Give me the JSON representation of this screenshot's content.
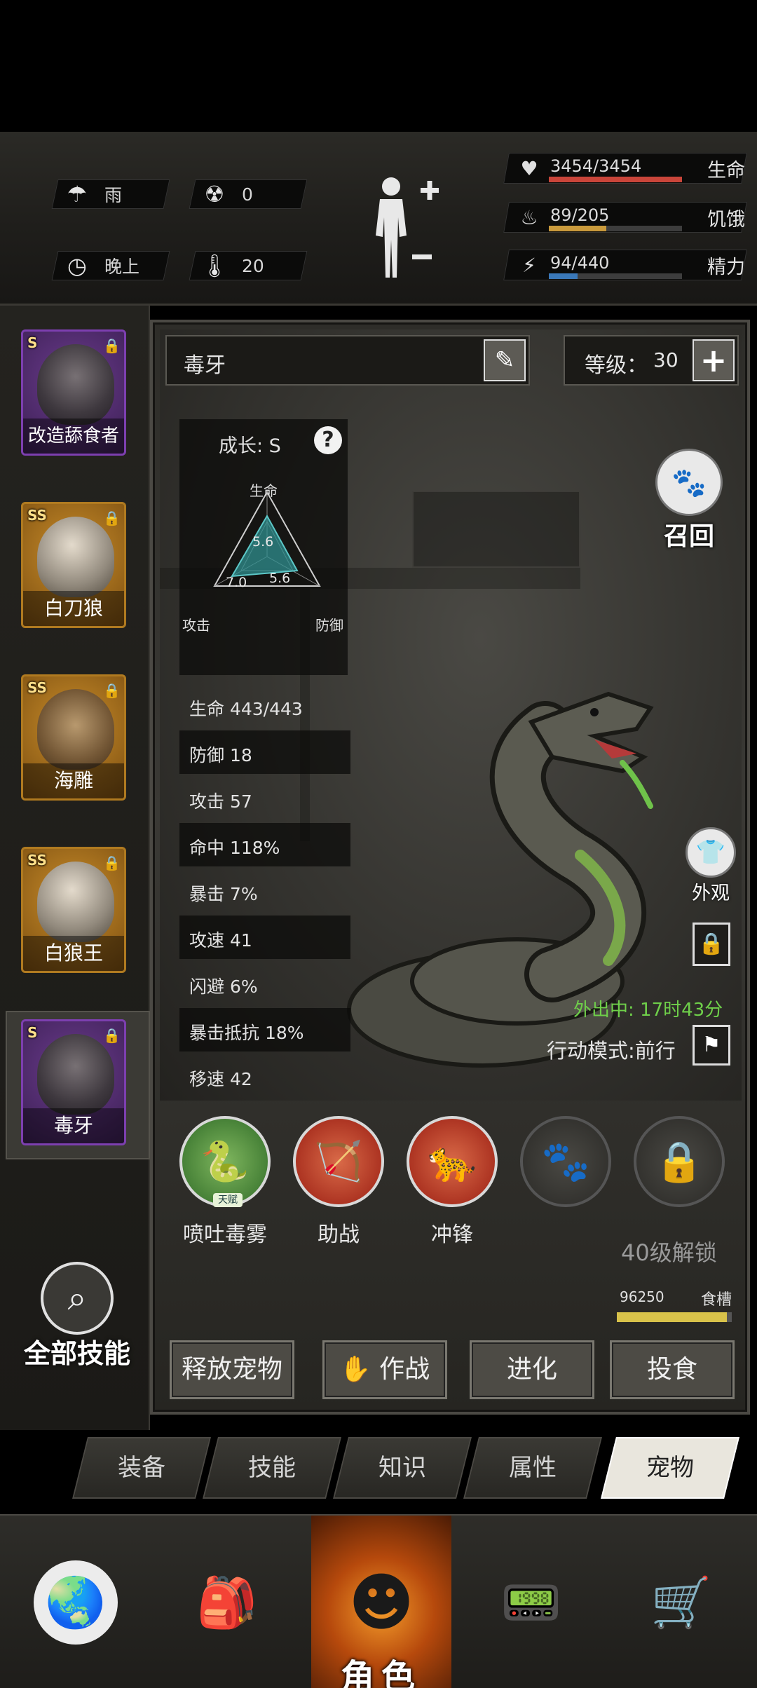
{
  "status": {
    "weather": "雨",
    "radiation": "0",
    "time_of_day": "晚上",
    "temperature": "20"
  },
  "vitals": [
    {
      "value": "3454/3454",
      "name": "生命",
      "fraction": 1.0,
      "color": "#c9453a",
      "icon": "heart-pulse-icon"
    },
    {
      "value": "89/205",
      "name": "饥饿",
      "fraction": 0.434,
      "color": "#c99a3c",
      "icon": "stomach-icon"
    },
    {
      "value": "94/440",
      "name": "精力",
      "fraction": 0.214,
      "color": "#3a78b8",
      "icon": "energy-head-icon"
    }
  ],
  "pets": [
    {
      "rank": "S",
      "name": "改造舔食者",
      "style": "purple"
    },
    {
      "rank": "SS",
      "name": "白刀狼",
      "style": "gold"
    },
    {
      "rank": "SS",
      "name": "海雕",
      "style": "gold"
    },
    {
      "rank": "SS",
      "name": "白狼王",
      "style": "gold"
    },
    {
      "rank": "S",
      "name": "毒牙",
      "style": "purple"
    }
  ],
  "all_skills_label": "全部技能",
  "pet_detail": {
    "name": "毒牙",
    "level_label": "等级：",
    "level": "30",
    "growth_label": "成长: S",
    "radar": {
      "axes": [
        "生命",
        "攻击",
        "防御"
      ],
      "values": {
        "hp": "5.6",
        "atk": "7.0",
        "def": "5.6"
      }
    },
    "stats": [
      "生命 443/443",
      "防御 18",
      "攻击 57",
      "命中 118%",
      "暴击 7%",
      "攻速 41",
      "闪避 6%",
      "暴击抵抗 18%",
      "移速 42"
    ],
    "recall_label": "召回",
    "appearance_label": "外观",
    "outing_status": "外出中: 17时43分",
    "action_mode": "行动模式:前行"
  },
  "skills": [
    {
      "name": "喷吐毒雾",
      "icon": "snake-venom-icon",
      "style": "green",
      "talent": "天赋"
    },
    {
      "name": "助战",
      "icon": "hunter-dog-icon",
      "style": "red"
    },
    {
      "name": "冲锋",
      "icon": "charging-beast-icon",
      "style": "red"
    },
    {
      "name": "",
      "icon": "paw-icon",
      "style": "empty"
    },
    {
      "name": "",
      "icon": "lock-icon",
      "style": "empty"
    }
  ],
  "unlock_label": "40级解锁",
  "food": {
    "value": "96250",
    "label": "食槽",
    "fraction": 0.96
  },
  "actions": [
    "释放宠物",
    "作战",
    "进化",
    "投食"
  ],
  "tabs": [
    "装备",
    "技能",
    "知识",
    "属性",
    "宠物"
  ],
  "active_tab": "宠物",
  "bottom_nav": {
    "role_label": "角色"
  }
}
